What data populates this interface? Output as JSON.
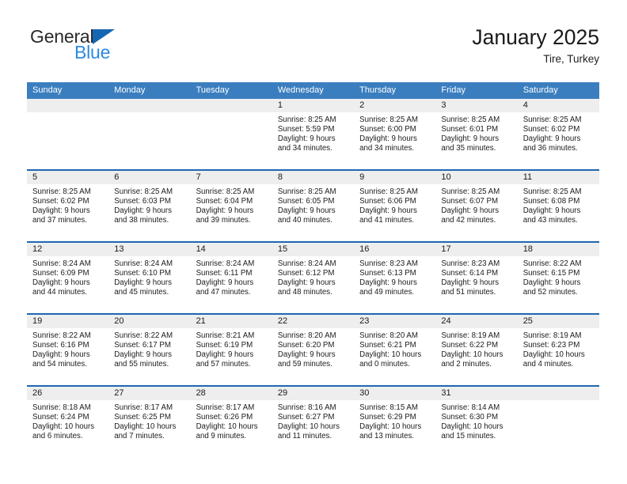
{
  "brand": {
    "name_part1": "General",
    "name_part2": "Blue",
    "triangle_color": "#1667b3",
    "blue_color": "#2b8ae0"
  },
  "header": {
    "title": "January 2025",
    "subtitle": "Tire, Turkey"
  },
  "theme": {
    "header_row_bg": "#3a7ebf",
    "week_divider": "#1f67ae",
    "daynum_band_bg": "#eeeeee"
  },
  "weekdays": [
    "Sunday",
    "Monday",
    "Tuesday",
    "Wednesday",
    "Thursday",
    "Friday",
    "Saturday"
  ],
  "weeks": [
    [
      {
        "day": "",
        "sunrise": "",
        "sunset": "",
        "daylight_line1": "",
        "daylight_line2": "",
        "empty": true
      },
      {
        "day": "",
        "sunrise": "",
        "sunset": "",
        "daylight_line1": "",
        "daylight_line2": "",
        "empty": true
      },
      {
        "day": "",
        "sunrise": "",
        "sunset": "",
        "daylight_line1": "",
        "daylight_line2": "",
        "empty": true
      },
      {
        "day": "1",
        "sunrise": "Sunrise: 8:25 AM",
        "sunset": "Sunset: 5:59 PM",
        "daylight_line1": "Daylight: 9 hours",
        "daylight_line2": "and 34 minutes."
      },
      {
        "day": "2",
        "sunrise": "Sunrise: 8:25 AM",
        "sunset": "Sunset: 6:00 PM",
        "daylight_line1": "Daylight: 9 hours",
        "daylight_line2": "and 34 minutes."
      },
      {
        "day": "3",
        "sunrise": "Sunrise: 8:25 AM",
        "sunset": "Sunset: 6:01 PM",
        "daylight_line1": "Daylight: 9 hours",
        "daylight_line2": "and 35 minutes."
      },
      {
        "day": "4",
        "sunrise": "Sunrise: 8:25 AM",
        "sunset": "Sunset: 6:02 PM",
        "daylight_line1": "Daylight: 9 hours",
        "daylight_line2": "and 36 minutes."
      }
    ],
    [
      {
        "day": "5",
        "sunrise": "Sunrise: 8:25 AM",
        "sunset": "Sunset: 6:02 PM",
        "daylight_line1": "Daylight: 9 hours",
        "daylight_line2": "and 37 minutes."
      },
      {
        "day": "6",
        "sunrise": "Sunrise: 8:25 AM",
        "sunset": "Sunset: 6:03 PM",
        "daylight_line1": "Daylight: 9 hours",
        "daylight_line2": "and 38 minutes."
      },
      {
        "day": "7",
        "sunrise": "Sunrise: 8:25 AM",
        "sunset": "Sunset: 6:04 PM",
        "daylight_line1": "Daylight: 9 hours",
        "daylight_line2": "and 39 minutes."
      },
      {
        "day": "8",
        "sunrise": "Sunrise: 8:25 AM",
        "sunset": "Sunset: 6:05 PM",
        "daylight_line1": "Daylight: 9 hours",
        "daylight_line2": "and 40 minutes."
      },
      {
        "day": "9",
        "sunrise": "Sunrise: 8:25 AM",
        "sunset": "Sunset: 6:06 PM",
        "daylight_line1": "Daylight: 9 hours",
        "daylight_line2": "and 41 minutes."
      },
      {
        "day": "10",
        "sunrise": "Sunrise: 8:25 AM",
        "sunset": "Sunset: 6:07 PM",
        "daylight_line1": "Daylight: 9 hours",
        "daylight_line2": "and 42 minutes."
      },
      {
        "day": "11",
        "sunrise": "Sunrise: 8:25 AM",
        "sunset": "Sunset: 6:08 PM",
        "daylight_line1": "Daylight: 9 hours",
        "daylight_line2": "and 43 minutes."
      }
    ],
    [
      {
        "day": "12",
        "sunrise": "Sunrise: 8:24 AM",
        "sunset": "Sunset: 6:09 PM",
        "daylight_line1": "Daylight: 9 hours",
        "daylight_line2": "and 44 minutes."
      },
      {
        "day": "13",
        "sunrise": "Sunrise: 8:24 AM",
        "sunset": "Sunset: 6:10 PM",
        "daylight_line1": "Daylight: 9 hours",
        "daylight_line2": "and 45 minutes."
      },
      {
        "day": "14",
        "sunrise": "Sunrise: 8:24 AM",
        "sunset": "Sunset: 6:11 PM",
        "daylight_line1": "Daylight: 9 hours",
        "daylight_line2": "and 47 minutes."
      },
      {
        "day": "15",
        "sunrise": "Sunrise: 8:24 AM",
        "sunset": "Sunset: 6:12 PM",
        "daylight_line1": "Daylight: 9 hours",
        "daylight_line2": "and 48 minutes."
      },
      {
        "day": "16",
        "sunrise": "Sunrise: 8:23 AM",
        "sunset": "Sunset: 6:13 PM",
        "daylight_line1": "Daylight: 9 hours",
        "daylight_line2": "and 49 minutes."
      },
      {
        "day": "17",
        "sunrise": "Sunrise: 8:23 AM",
        "sunset": "Sunset: 6:14 PM",
        "daylight_line1": "Daylight: 9 hours",
        "daylight_line2": "and 51 minutes."
      },
      {
        "day": "18",
        "sunrise": "Sunrise: 8:22 AM",
        "sunset": "Sunset: 6:15 PM",
        "daylight_line1": "Daylight: 9 hours",
        "daylight_line2": "and 52 minutes."
      }
    ],
    [
      {
        "day": "19",
        "sunrise": "Sunrise: 8:22 AM",
        "sunset": "Sunset: 6:16 PM",
        "daylight_line1": "Daylight: 9 hours",
        "daylight_line2": "and 54 minutes."
      },
      {
        "day": "20",
        "sunrise": "Sunrise: 8:22 AM",
        "sunset": "Sunset: 6:17 PM",
        "daylight_line1": "Daylight: 9 hours",
        "daylight_line2": "and 55 minutes."
      },
      {
        "day": "21",
        "sunrise": "Sunrise: 8:21 AM",
        "sunset": "Sunset: 6:19 PM",
        "daylight_line1": "Daylight: 9 hours",
        "daylight_line2": "and 57 minutes."
      },
      {
        "day": "22",
        "sunrise": "Sunrise: 8:20 AM",
        "sunset": "Sunset: 6:20 PM",
        "daylight_line1": "Daylight: 9 hours",
        "daylight_line2": "and 59 minutes."
      },
      {
        "day": "23",
        "sunrise": "Sunrise: 8:20 AM",
        "sunset": "Sunset: 6:21 PM",
        "daylight_line1": "Daylight: 10 hours",
        "daylight_line2": "and 0 minutes."
      },
      {
        "day": "24",
        "sunrise": "Sunrise: 8:19 AM",
        "sunset": "Sunset: 6:22 PM",
        "daylight_line1": "Daylight: 10 hours",
        "daylight_line2": "and 2 minutes."
      },
      {
        "day": "25",
        "sunrise": "Sunrise: 8:19 AM",
        "sunset": "Sunset: 6:23 PM",
        "daylight_line1": "Daylight: 10 hours",
        "daylight_line2": "and 4 minutes."
      }
    ],
    [
      {
        "day": "26",
        "sunrise": "Sunrise: 8:18 AM",
        "sunset": "Sunset: 6:24 PM",
        "daylight_line1": "Daylight: 10 hours",
        "daylight_line2": "and 6 minutes."
      },
      {
        "day": "27",
        "sunrise": "Sunrise: 8:17 AM",
        "sunset": "Sunset: 6:25 PM",
        "daylight_line1": "Daylight: 10 hours",
        "daylight_line2": "and 7 minutes."
      },
      {
        "day": "28",
        "sunrise": "Sunrise: 8:17 AM",
        "sunset": "Sunset: 6:26 PM",
        "daylight_line1": "Daylight: 10 hours",
        "daylight_line2": "and 9 minutes."
      },
      {
        "day": "29",
        "sunrise": "Sunrise: 8:16 AM",
        "sunset": "Sunset: 6:27 PM",
        "daylight_line1": "Daylight: 10 hours",
        "daylight_line2": "and 11 minutes."
      },
      {
        "day": "30",
        "sunrise": "Sunrise: 8:15 AM",
        "sunset": "Sunset: 6:29 PM",
        "daylight_line1": "Daylight: 10 hours",
        "daylight_line2": "and 13 minutes."
      },
      {
        "day": "31",
        "sunrise": "Sunrise: 8:14 AM",
        "sunset": "Sunset: 6:30 PM",
        "daylight_line1": "Daylight: 10 hours",
        "daylight_line2": "and 15 minutes."
      },
      {
        "day": "",
        "sunrise": "",
        "sunset": "",
        "daylight_line1": "",
        "daylight_line2": "",
        "empty": true
      }
    ]
  ]
}
